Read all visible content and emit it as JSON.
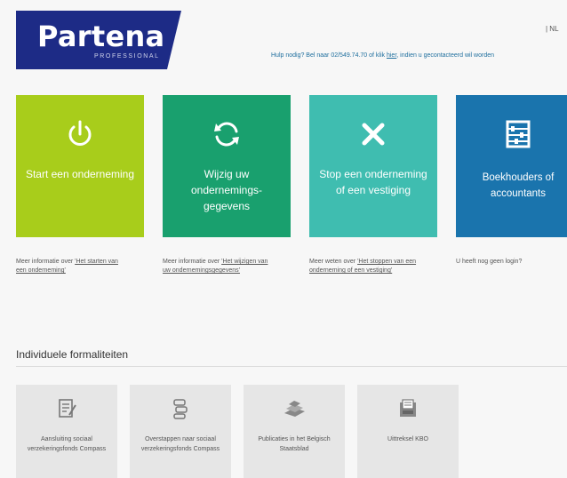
{
  "brand": {
    "name": "Partena",
    "sub": "PROFESSIONAL"
  },
  "header": {
    "lang": "| NL",
    "help_text": "Hulp nodig? Bel naar 02/549.74.70 of klik ",
    "help_link": "hier",
    "help_suffix": ", indien u gecontacteerd wil worden"
  },
  "colors": {
    "green_light": "#a8cd1b",
    "green": "#19a06e",
    "teal": "#3fbdb0",
    "blue": "#1a74ad",
    "brand": "#1d2b86"
  },
  "tiles": [
    {
      "label": "Start een onderneming",
      "icon": "power-icon"
    },
    {
      "label": "Wijzig uw ondernemings-gegevens",
      "icon": "refresh-icon"
    },
    {
      "label": "Stop een onderneming of een vestiging",
      "icon": "close-icon"
    },
    {
      "label": "Boekhouders of accountants",
      "icon": "abacus-icon"
    }
  ],
  "info": [
    {
      "text": "Meer informatie over ",
      "link": "'Het starten van een onderneming'"
    },
    {
      "text": "Meer informatie over ",
      "link": "'Het wijzigen van uw ondernemingsgegevens'"
    },
    {
      "text": "Meer weten over ",
      "link": "'Het stoppen van een onderneming of een vestiging'"
    },
    {
      "text": "U heeft nog geen login?",
      "link": ""
    }
  ],
  "section": {
    "title": "Individuele formaliteiten"
  },
  "cards": [
    {
      "label": "Aansluiting sociaal verzekeringsfonds Compass",
      "icon": "document-edit-icon"
    },
    {
      "label": "Overstappen naar sociaal verzekeringsfonds Compass",
      "icon": "transfer-icon"
    },
    {
      "label": "Publicaties in het Belgisch Staatsblad",
      "icon": "publication-icon"
    },
    {
      "label": "Uittreksel KBO",
      "icon": "extract-icon"
    }
  ]
}
